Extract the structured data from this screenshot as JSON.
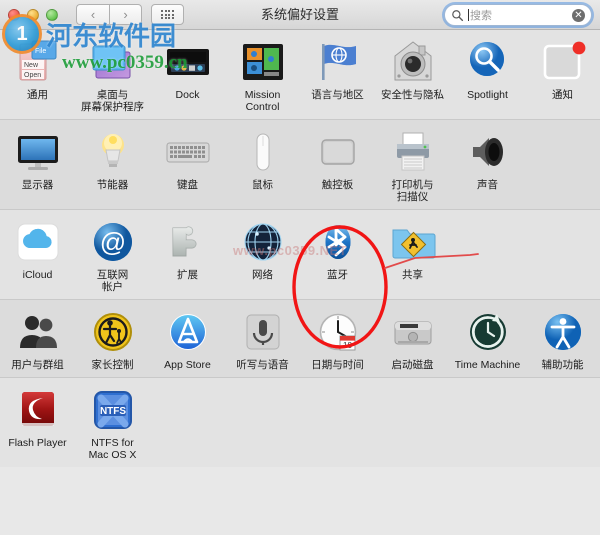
{
  "window": {
    "title": "系统偏好设置",
    "traffic_lights": [
      {
        "name": "close",
        "color": "#ec4f43"
      },
      {
        "name": "minimize",
        "color": "#e9ab2e"
      },
      {
        "name": "zoom",
        "color": "#5fc24a"
      }
    ],
    "nav": {
      "back_label": "‹",
      "forward_label": "›",
      "grid_label": "grid-view"
    },
    "search": {
      "placeholder": "搜索",
      "value": "",
      "clear_label": "✕",
      "focused": true,
      "focus_color": "#5696e1"
    }
  },
  "rows": [
    {
      "band": "band-a",
      "items": [
        {
          "label": "通用",
          "icon": "general-icon"
        },
        {
          "label": "桌面与\n屏幕保护程序",
          "icon": "desktop-screensaver-icon"
        },
        {
          "label": "Dock",
          "icon": "dock-icon"
        },
        {
          "label": "Mission\nControl",
          "icon": "mission-control-icon"
        },
        {
          "label": "语言与地区",
          "icon": "language-region-icon"
        },
        {
          "label": "安全性与隐私",
          "icon": "security-privacy-icon"
        },
        {
          "label": "Spotlight",
          "icon": "spotlight-icon"
        },
        {
          "label": "通知",
          "icon": "notifications-icon"
        }
      ]
    },
    {
      "band": "band-b",
      "items": [
        {
          "label": "显示器",
          "icon": "displays-icon"
        },
        {
          "label": "节能器",
          "icon": "energy-saver-icon"
        },
        {
          "label": "键盘",
          "icon": "keyboard-icon"
        },
        {
          "label": "鼠标",
          "icon": "mouse-icon"
        },
        {
          "label": "触控板",
          "icon": "trackpad-icon"
        },
        {
          "label": "打印机与\n扫描仪",
          "icon": "printers-scanners-icon"
        },
        {
          "label": "声音",
          "icon": "sound-icon"
        },
        {
          "label": "",
          "icon": ""
        }
      ]
    },
    {
      "band": "band-a",
      "items": [
        {
          "label": "iCloud",
          "icon": "icloud-icon"
        },
        {
          "label": "互联网\n帐户",
          "icon": "internet-accounts-icon"
        },
        {
          "label": "扩展",
          "icon": "extensions-icon"
        },
        {
          "label": "网络",
          "icon": "network-icon"
        },
        {
          "label": "蓝牙",
          "icon": "bluetooth-icon"
        },
        {
          "label": "共享",
          "icon": "sharing-icon"
        },
        {
          "label": "",
          "icon": ""
        },
        {
          "label": "",
          "icon": ""
        }
      ]
    },
    {
      "band": "band-b",
      "items": [
        {
          "label": "用户与群组",
          "icon": "users-groups-icon"
        },
        {
          "label": "家长控制",
          "icon": "parental-controls-icon"
        },
        {
          "label": "App Store",
          "icon": "app-store-icon"
        },
        {
          "label": "听写与语音",
          "icon": "dictation-speech-icon"
        },
        {
          "label": "日期与时间",
          "icon": "date-time-icon"
        },
        {
          "label": "启动磁盘",
          "icon": "startup-disk-icon"
        },
        {
          "label": "Time Machine",
          "icon": "time-machine-icon"
        },
        {
          "label": "辅助功能",
          "icon": "accessibility-icon"
        }
      ]
    },
    {
      "band": "band-a",
      "items": [
        {
          "label": "Flash Player",
          "icon": "flash-player-icon"
        },
        {
          "label": "NTFS for\nMac OS X",
          "icon": "ntfs-icon"
        },
        {
          "label": "",
          "icon": ""
        },
        {
          "label": "",
          "icon": ""
        },
        {
          "label": "",
          "icon": ""
        },
        {
          "label": "",
          "icon": ""
        },
        {
          "label": "",
          "icon": ""
        },
        {
          "label": "",
          "icon": ""
        }
      ]
    }
  ],
  "annotation": {
    "color": "#f11515",
    "target": "蓝牙",
    "shape": "ellipse-with-leader-line"
  },
  "watermarks": {
    "logo_text": "河东软件园",
    "logo_badge": "1",
    "url": "www.pc0359.cn",
    "faint": "www.pc0359.NET"
  }
}
